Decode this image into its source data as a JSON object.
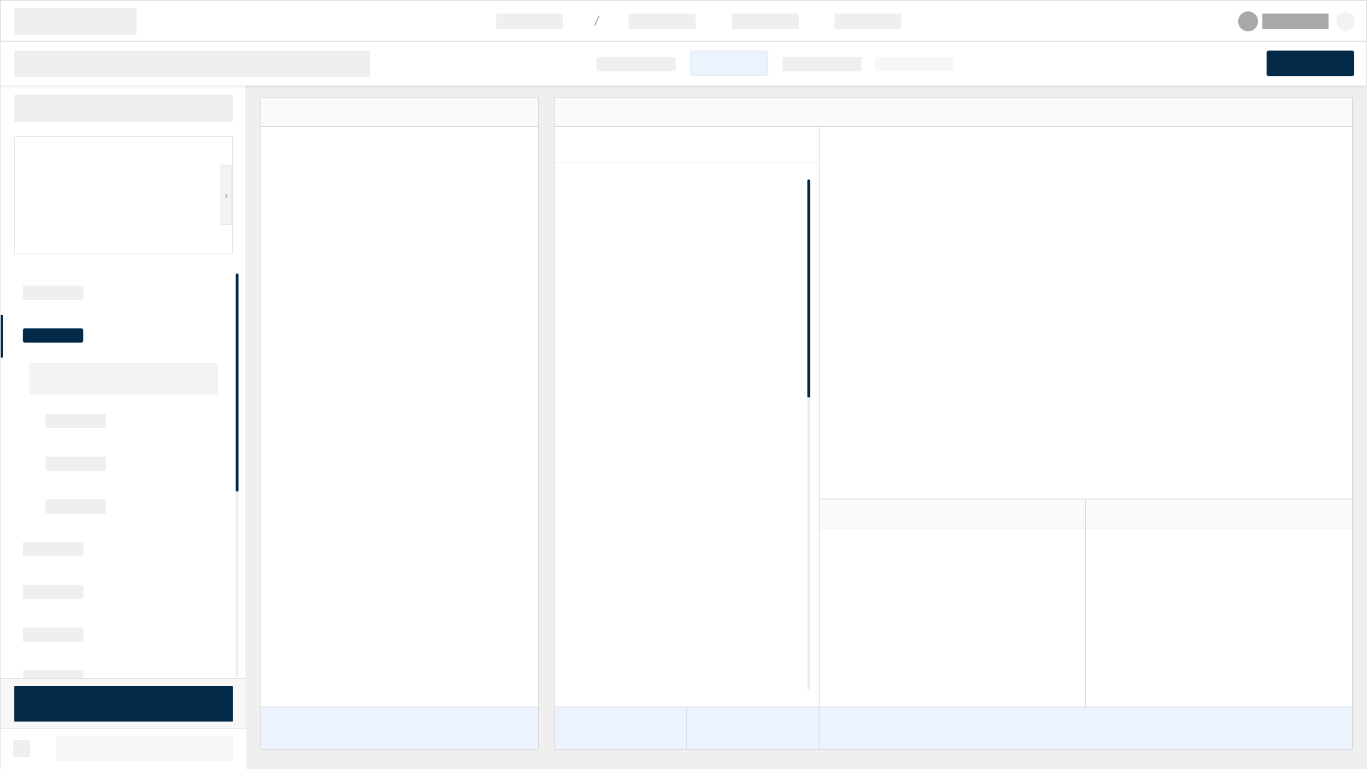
{
  "header": {
    "separator": "/"
  },
  "sidebar": {
    "preview_toggle": "›"
  },
  "colors": {
    "primary": "#022a48",
    "active_tab": "#ecf3fd",
    "footer_band": "#ecf3fd",
    "placeholder": "#efefef",
    "workspace_bg": "#efefef",
    "avatar": "#a8a8a8"
  }
}
